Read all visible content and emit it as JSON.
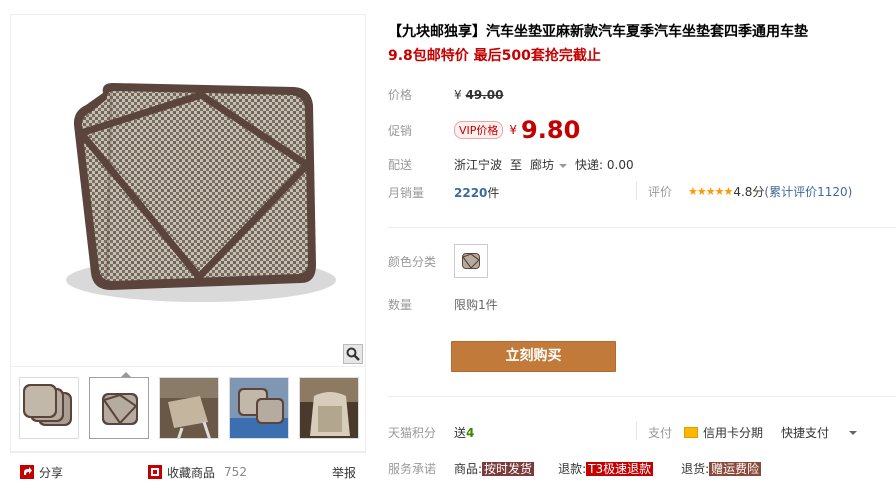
{
  "gallery": {
    "thumbs": [
      {
        "alt": "cushion-stack"
      },
      {
        "alt": "cushion-single"
      },
      {
        "alt": "chair-scene"
      },
      {
        "alt": "cushion-pile"
      },
      {
        "alt": "car-seat-scene"
      }
    ],
    "share_label": "分享",
    "fav_label": "收藏商品",
    "fav_count": "752",
    "report_label": "举报"
  },
  "product": {
    "title": "【九块邮独享】汽车坐垫亚麻新款汽车夏季汽车坐垫套四季通用车垫",
    "subtitle": "9.8包邮特价 最后500套抢完截止"
  },
  "price": {
    "label": "价格",
    "currency": "¥",
    "value": "49.00"
  },
  "promo": {
    "label": "促销",
    "vip_tag": "VIP价格",
    "currency": "¥",
    "value": "9.80"
  },
  "delivery": {
    "label": "配送",
    "from": "浙江宁波",
    "to_label": "至",
    "to": "廊坊",
    "express": "快递: 0.00"
  },
  "sales": {
    "label": "月销量",
    "count": "2220",
    "unit": "件"
  },
  "rating": {
    "label": "评价",
    "stars": "★★★★★",
    "score": "4.8分",
    "count_text": "(累计评价1120)"
  },
  "options": {
    "color_label": "颜色分类",
    "qty_label": "数量",
    "qty_limit": "限购1件"
  },
  "buy_button": "立刻购买",
  "bottom": {
    "points_label": "天猫积分",
    "points_text": "送",
    "points_value": "4",
    "pay_label": "支付",
    "pay_card": "信用卡分期",
    "pay_quick": "快捷支付",
    "service_label": "服务承诺",
    "service_items": [
      {
        "prefix": "商品:",
        "tag": "按时发货"
      },
      {
        "prefix": "退款:",
        "tag": "T3极速退款"
      },
      {
        "prefix": "退货:",
        "tag": "赠运费险"
      }
    ]
  },
  "colors": {
    "price_red": "#c40000",
    "buy_button": "#c27a3b",
    "link_blue": "#3d6a9c",
    "star": "#ff9900"
  }
}
